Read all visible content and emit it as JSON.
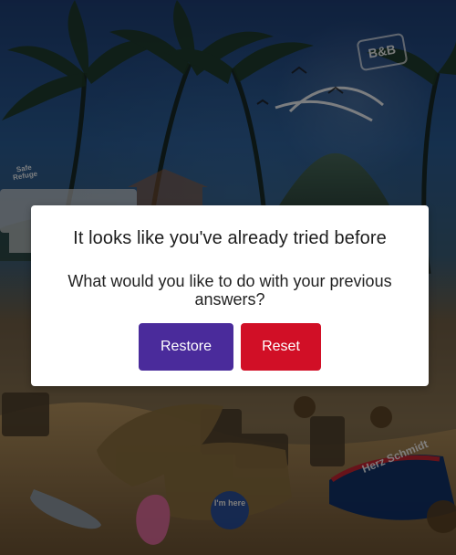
{
  "dialog": {
    "title": "It looks like you've already tried before",
    "question": "What would you like to do with your previous answers?",
    "buttons": {
      "restore": "Restore",
      "reset": "Reset"
    }
  },
  "background": {
    "signs": {
      "bnb": "B&B",
      "safe_refuge": "Safe Refuge",
      "here": "I'm here",
      "towel": "Herz Schmidt"
    }
  }
}
